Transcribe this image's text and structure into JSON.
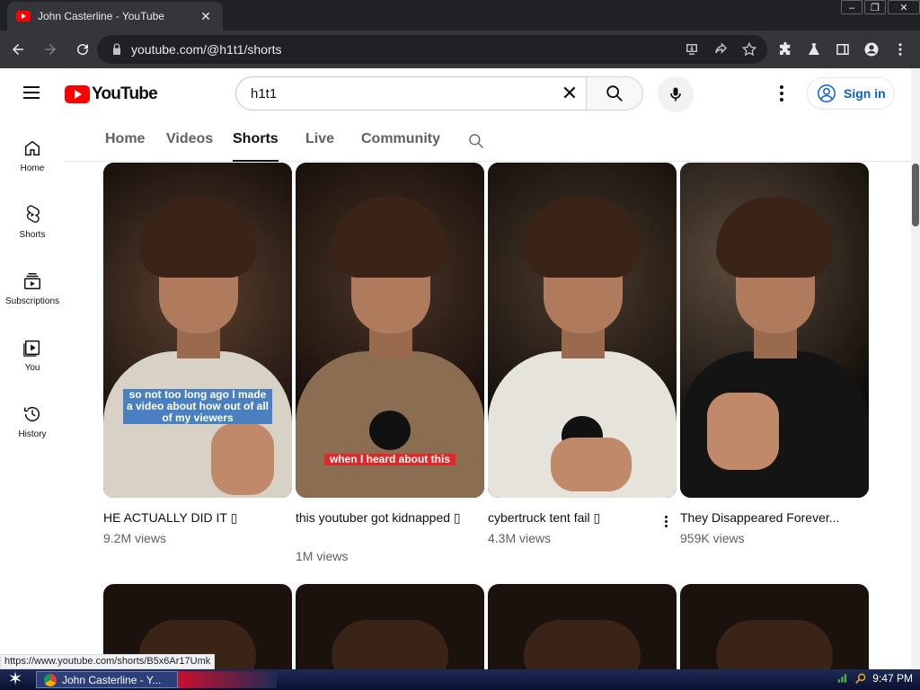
{
  "browser": {
    "tab_title": "John Casterline - YouTube",
    "tab_close": "✕",
    "url": "youtube.com/@h1t1/shorts",
    "window_controls": [
      "–",
      "❐",
      "✕"
    ]
  },
  "header": {
    "logo_text": "YouTube",
    "search_query": "h1t1",
    "clear_symbol": "✕",
    "signin_label": "Sign in"
  },
  "guide": [
    {
      "label": "Home",
      "icon": "home-icon"
    },
    {
      "label": "Shorts",
      "icon": "shorts-icon"
    },
    {
      "label": "Subscriptions",
      "icon": "subscriptions-icon"
    },
    {
      "label": "You",
      "icon": "library-icon"
    },
    {
      "label": "History",
      "icon": "history-icon"
    }
  ],
  "channel_tabs": [
    {
      "label": "Home",
      "active": false
    },
    {
      "label": "Videos",
      "active": false
    },
    {
      "label": "Shorts",
      "active": true
    },
    {
      "label": "Live",
      "active": false
    },
    {
      "label": "Community",
      "active": false
    }
  ],
  "shorts": [
    {
      "title": "HE ACTUALLY DID IT ▯",
      "views": "9.2M views",
      "caption": "so not too long ago I made a video about how out of all of my viewers",
      "caption_style": "blue",
      "shirt_color": "#d8d2c6"
    },
    {
      "title": "this youtuber got kidnapped ▯",
      "views": "1M views",
      "caption": "when I heard about this",
      "caption_style": "red",
      "shirt_color": "#8b6d52"
    },
    {
      "title": "cybertruck tent fail ▯",
      "views": "4.3M views",
      "caption": "",
      "caption_style": "",
      "shirt_color": "#e6e3dc"
    },
    {
      "title": "They Disappeared Forever...",
      "views": "959K views",
      "caption": "",
      "caption_style": "",
      "shirt_color": "#141414"
    }
  ],
  "status_link": "https://www.youtube.com/shorts/B5x6Ar17Umk",
  "taskbar": {
    "start_symbol": "✶",
    "task_label": "John Casterline - Y...",
    "clock": "9:47 PM"
  },
  "colors": {
    "accent_red": "#ff0000",
    "link_blue": "#065fd4",
    "chrome_dark": "#202124"
  }
}
